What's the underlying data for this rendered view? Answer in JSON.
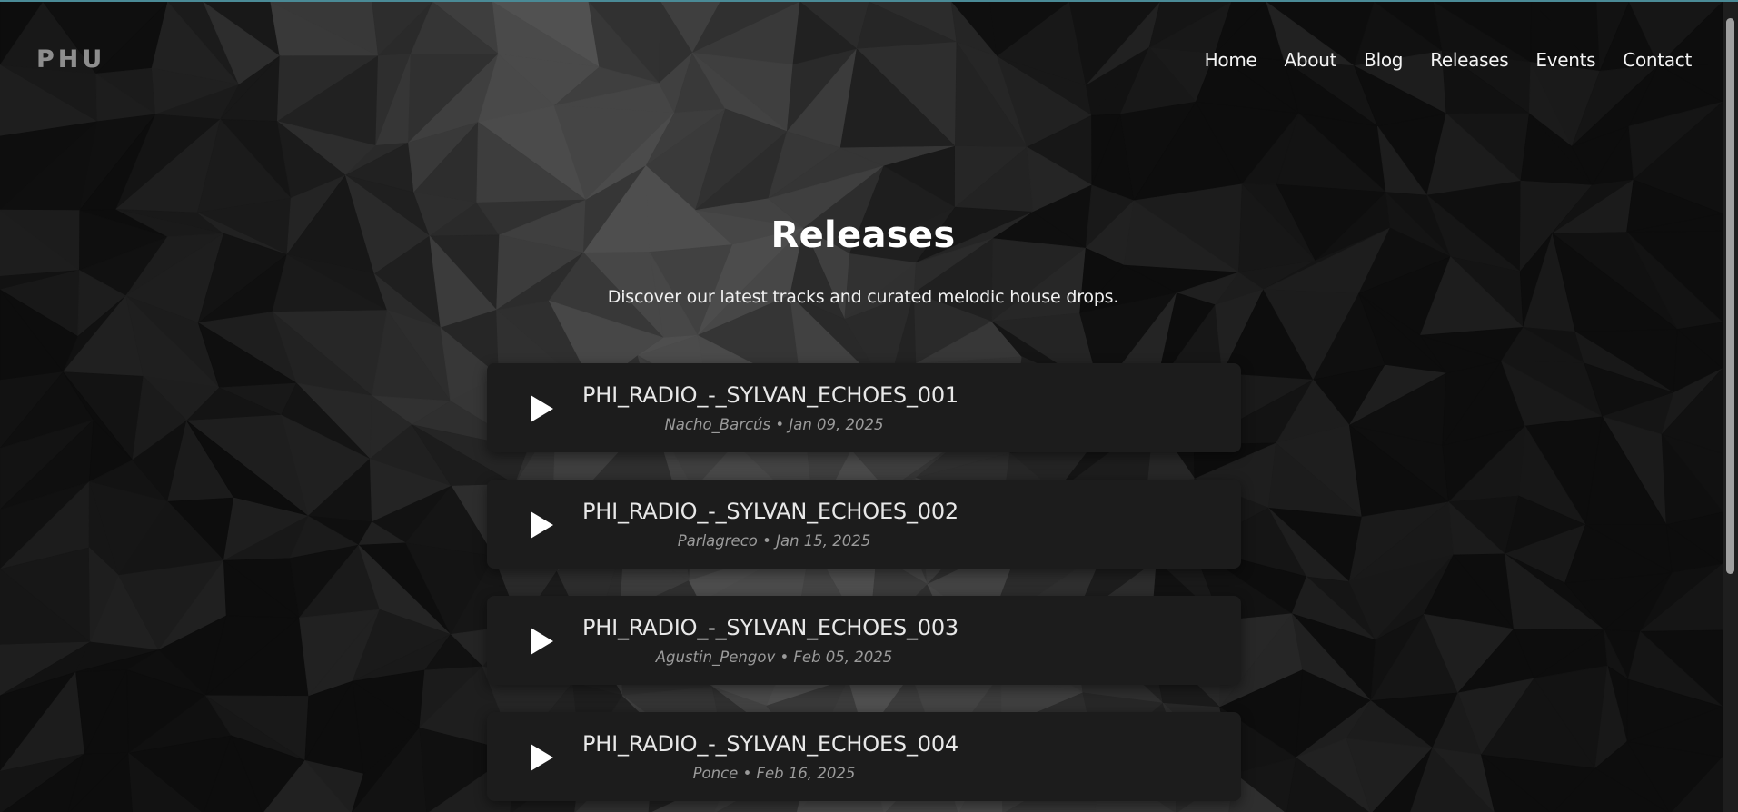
{
  "logo": "PHU",
  "nav": [
    "Home",
    "About",
    "Blog",
    "Releases",
    "Events",
    "Contact"
  ],
  "hero": {
    "title": "Releases",
    "subtitle": "Discover our latest tracks and curated melodic house drops."
  },
  "releases": [
    {
      "title": "PHI_RADIO_-_SYLVAN_ECHOES_001",
      "meta": "Nacho_Barcús • Jan 09, 2025"
    },
    {
      "title": "PHI_RADIO_-_SYLVAN_ECHOES_002",
      "meta": "Parlagreco • Jan 15, 2025"
    },
    {
      "title": "PHI_RADIO_-_SYLVAN_ECHOES_003",
      "meta": "Agustin_Pengov • Feb 05, 2025"
    },
    {
      "title": "PHI_RADIO_-_SYLVAN_ECHOES_004",
      "meta": "Ponce • Feb 16, 2025"
    }
  ],
  "icons": {
    "play": "play-icon"
  },
  "colors": {
    "background": "#151515",
    "card": "#1c1c1c",
    "accent_bar": "#4a8a96"
  }
}
